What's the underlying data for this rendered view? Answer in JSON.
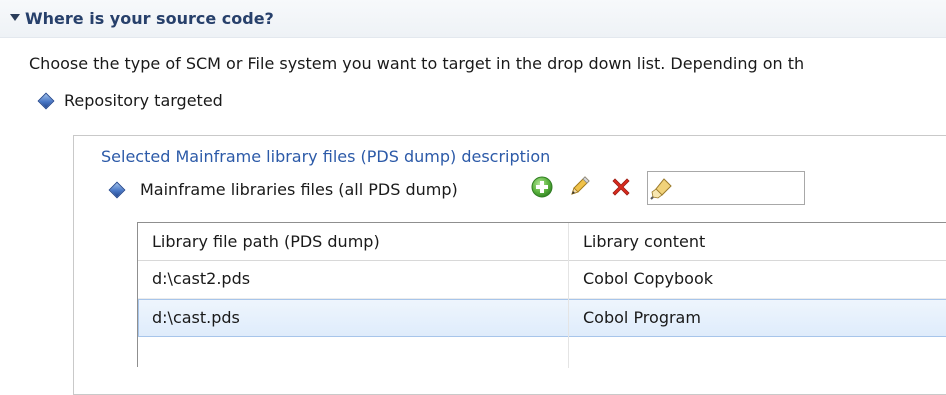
{
  "section": {
    "title": "Where is your source code?",
    "description": "Choose the type of SCM or File system you want to target in the drop down list. Depending on th"
  },
  "repository": {
    "label": "Repository targeted"
  },
  "group": {
    "title": "Selected Mainframe library files (PDS dump) description",
    "libraries_label": "Mainframe libraries files (all PDS dump)",
    "path_value": ""
  },
  "toolbar": {
    "icons": [
      "add-icon",
      "edit-pencil-icon",
      "remove-x-icon",
      "browse-brush-icon"
    ],
    "colors": {
      "add": "#3f9a2e",
      "remove": "#d92b1e",
      "pencil": "#e8b533"
    }
  },
  "table": {
    "columns": [
      "Library file path (PDS dump)",
      "Library content"
    ],
    "rows": [
      [
        "d:\\cast2.pds",
        "Cobol Copybook"
      ],
      [
        "d:\\cast.pds",
        "Cobol Program"
      ],
      [
        "",
        ""
      ]
    ],
    "selected_row": 1
  },
  "colors": {
    "header_title": "#27406b",
    "group_title": "#2c5aa8",
    "selection": "#dfecfb",
    "selection_border": "#a7c5ea"
  }
}
